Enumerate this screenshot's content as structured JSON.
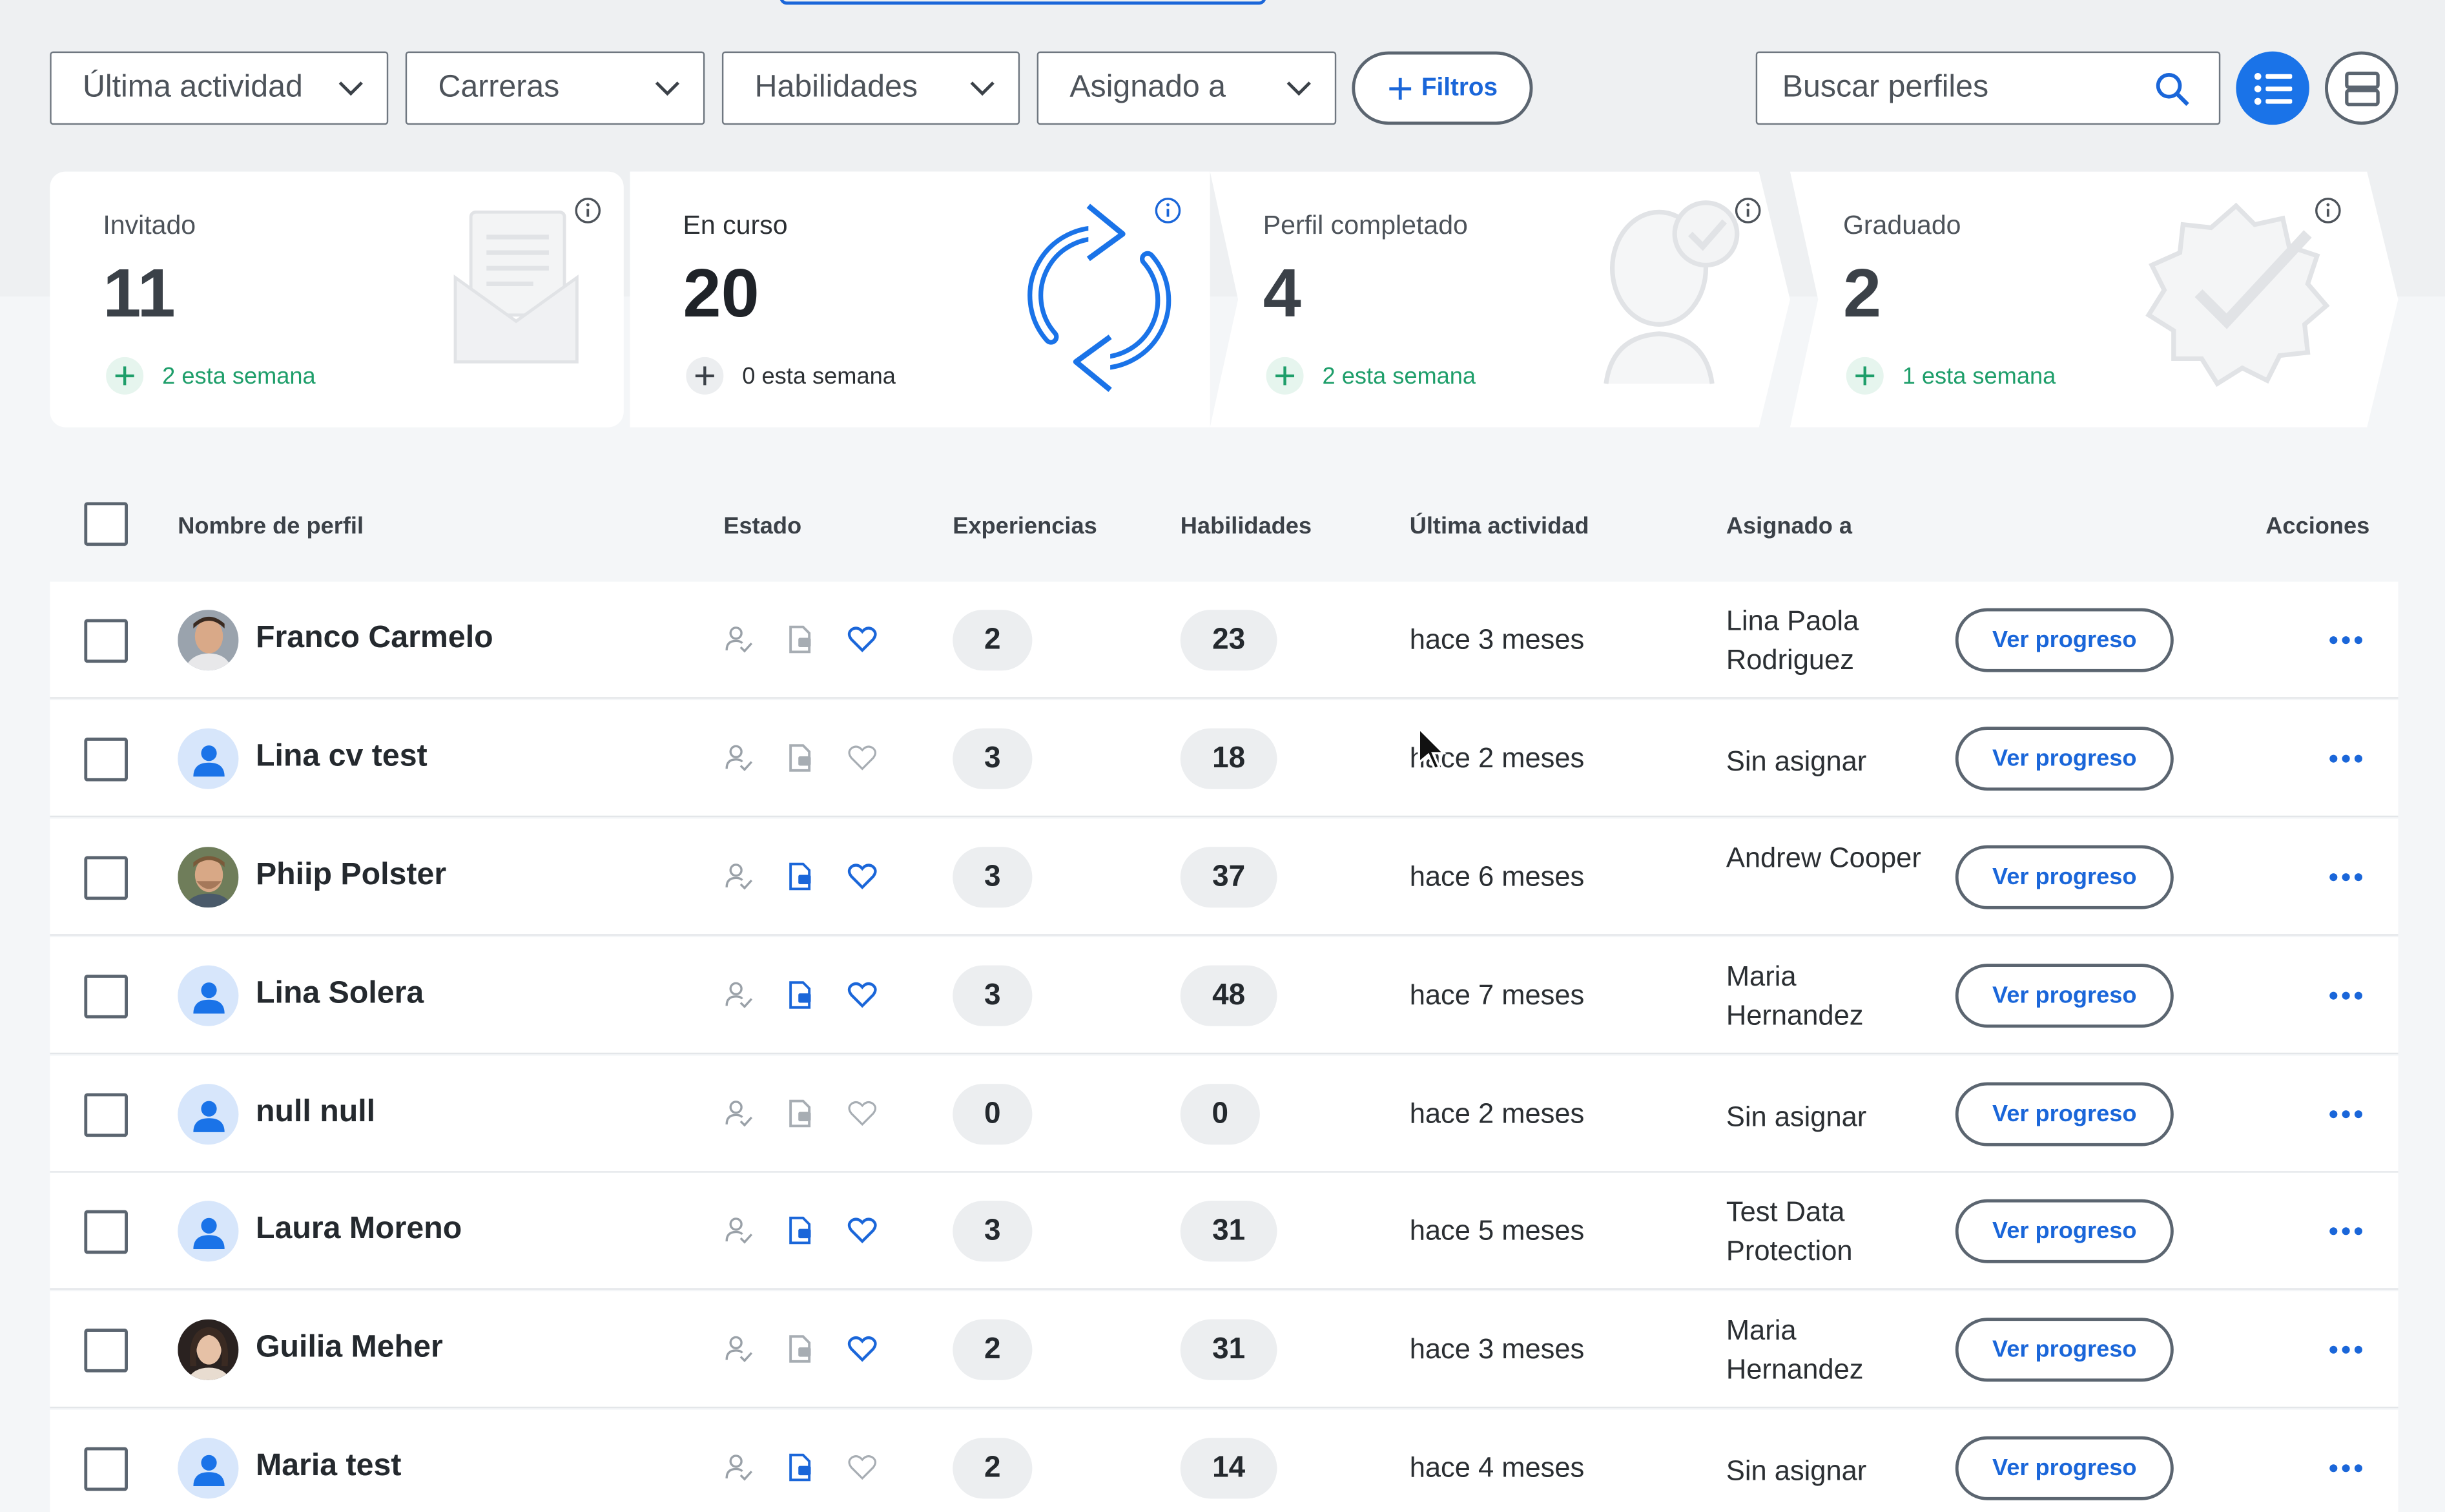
{
  "filters": {
    "last_activity": "Última actividad",
    "careers": "Carreras",
    "skills": "Habilidades",
    "assigned_to": "Asignado a",
    "filters_button": "Filtros"
  },
  "search": {
    "placeholder": "Buscar perfiles"
  },
  "stats": [
    {
      "label": "Invitado",
      "value": "11",
      "delta": "2 esta semana"
    },
    {
      "label": "En curso",
      "value": "20",
      "delta": "0 esta semana"
    },
    {
      "label": "Perfil completado",
      "value": "4",
      "delta": "2 esta semana"
    },
    {
      "label": "Graduado",
      "value": "2",
      "delta": "1 esta semana"
    }
  ],
  "table": {
    "headers": {
      "name": "Nombre de perfil",
      "status": "Estado",
      "experiences": "Experiencias",
      "skills": "Habilidades",
      "last_activity": "Última actividad",
      "assigned": "Asignado a",
      "actions": "Acciones"
    },
    "rows": [
      {
        "name": "Franco Carmelo",
        "avatar": "photo-man",
        "cv": false,
        "fav": true,
        "experiences": "2",
        "skills": "23",
        "last": "hace 3 meses",
        "assigned": "Lina Paola Rodriguez",
        "action": "Ver progreso"
      },
      {
        "name": "Lina cv test",
        "avatar": "default",
        "cv": false,
        "fav": false,
        "experiences": "3",
        "skills": "18",
        "last": "hace 2 meses",
        "assigned": "Sin asignar",
        "action": "Ver progreso"
      },
      {
        "name": "Phiip Polster",
        "avatar": "photo-man2",
        "cv": true,
        "fav": true,
        "experiences": "3",
        "skills": "37",
        "last": "hace 6 meses",
        "assigned": "Andrew Cooper",
        "action": "Ver progreso"
      },
      {
        "name": "Lina Solera",
        "avatar": "default",
        "cv": true,
        "fav": true,
        "experiences": "3",
        "skills": "48",
        "last": "hace 7 meses",
        "assigned": "Maria Hernandez",
        "action": "Ver progreso"
      },
      {
        "name": "null null",
        "avatar": "default",
        "cv": false,
        "fav": false,
        "experiences": "0",
        "skills": "0",
        "last": "hace 2 meses",
        "assigned": "Sin asignar",
        "action": "Ver progreso"
      },
      {
        "name": "Laura Moreno",
        "avatar": "default",
        "cv": true,
        "fav": true,
        "experiences": "3",
        "skills": "31",
        "last": "hace 5 meses",
        "assigned": "Test Data Protection",
        "action": "Ver progreso"
      },
      {
        "name": "Guilia Meher",
        "avatar": "photo-woman",
        "cv": false,
        "fav": true,
        "experiences": "2",
        "skills": "31",
        "last": "hace 3 meses",
        "assigned": "Maria Hernandez",
        "action": "Ver progreso"
      },
      {
        "name": "Maria test",
        "avatar": "default",
        "cv": true,
        "fav": false,
        "experiences": "2",
        "skills": "14",
        "last": "hace 4 meses",
        "assigned": "Sin asignar",
        "action": "Ver progreso"
      }
    ]
  },
  "colors": {
    "accent": "#1a66d9",
    "success": "#1e9e6a"
  }
}
